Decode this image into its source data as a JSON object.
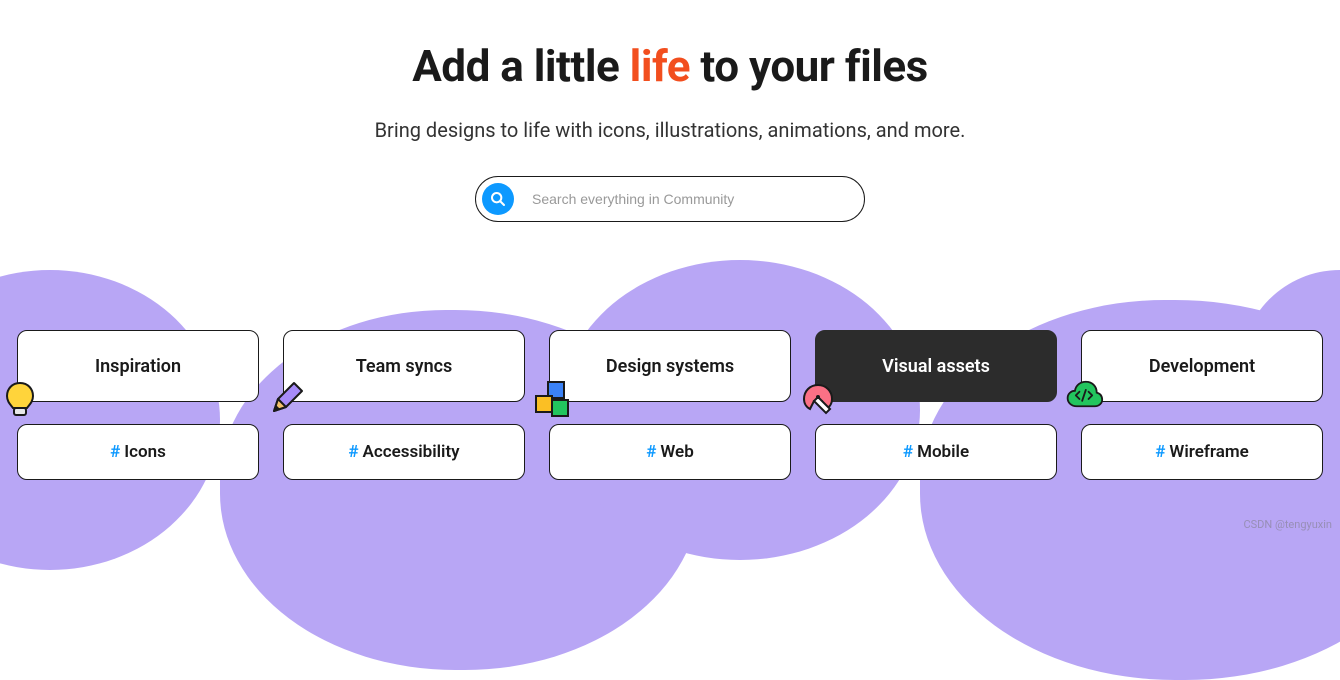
{
  "hero": {
    "title_pre": "Add a little ",
    "title_accent": "life",
    "title_post": " to your files",
    "subtitle": "Bring designs to life with icons, illustrations, animations, and more."
  },
  "search": {
    "placeholder": "Search everything in Community"
  },
  "categories": [
    {
      "label": "Inspiration",
      "icon": "lightbulb",
      "dark": false
    },
    {
      "label": "Team syncs",
      "icon": "pencil",
      "dark": false
    },
    {
      "label": "Design systems",
      "icon": "squares",
      "dark": false
    },
    {
      "label": "Visual assets",
      "icon": "pen-tool",
      "dark": true
    },
    {
      "label": "Development",
      "icon": "cloud-code",
      "dark": false
    }
  ],
  "tags": [
    {
      "label": "Icons"
    },
    {
      "label": "Accessibility"
    },
    {
      "label": "Web"
    },
    {
      "label": "Mobile"
    },
    {
      "label": "Wireframe"
    }
  ],
  "hash_symbol": "#",
  "watermark": "CSDN @tengyuxin"
}
